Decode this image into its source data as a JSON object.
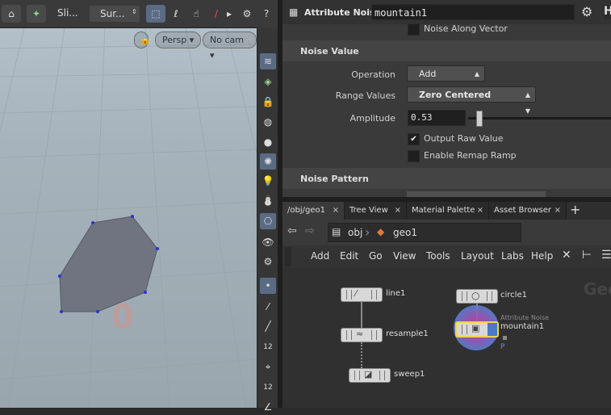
{
  "viewport": {
    "toolbar": {
      "select_label": "Sli...",
      "surface_label": "Sur..."
    },
    "camera_menu": "Persp",
    "cam_menu": "No cam",
    "overlay_digit": "0"
  },
  "shelf": {
    "icons": [
      "layers-icon",
      "visibility-icon",
      "lock-icon",
      "ghost-icon",
      "shading-icon",
      "light-icon",
      "light-bulb-icon",
      "render-icon",
      "camera-icon",
      "eye-icon",
      "settings-icon",
      "point-icon",
      "edge-icon",
      "face-icon",
      "number-icon",
      "brush-icon",
      "number2-icon",
      "angle-icon"
    ],
    "labels": {
      "number1": "12",
      "number2": "12"
    }
  },
  "params": {
    "node_type": "Attribute Noise",
    "node_name": "mountain1",
    "noise_along_vector": "Noise Along Vector",
    "sections": {
      "noise_value": "Noise Value",
      "noise_pattern": "Noise Pattern"
    },
    "operation_label": "Operation",
    "operation_value": "Add",
    "range_label": "Range Values",
    "range_value": "Zero Centered",
    "amplitude_label": "Amplitude",
    "amplitude_value": "0.53",
    "output_raw_label": "Output Raw Value",
    "enable_remap_label": "Enable Remap Ramp"
  },
  "network": {
    "tabs": [
      {
        "label": "/obj/geo1",
        "close": "×"
      },
      {
        "label": "Tree View",
        "close": "×"
      },
      {
        "label": "Material Palette",
        "close": "×"
      },
      {
        "label": "Asset Browser",
        "close": "×"
      }
    ],
    "add_tab": "+",
    "path": {
      "obj": "obj",
      "geo": "geo1"
    },
    "menu": [
      "Add",
      "Edit",
      "Go",
      "View",
      "Tools",
      "Layout",
      "Labs",
      "Help"
    ],
    "nodes": {
      "line": "line1",
      "resample": "resample1",
      "sweep": "sweep1",
      "circle": "circle1",
      "mountain_type": "Attribute Noise",
      "mountain": "mountain1",
      "mountain_flag": "P"
    },
    "watermark": "Geo"
  },
  "colors": {
    "accent": "#f3d24a",
    "select": "#5a6b84",
    "node_blue": "#4b79c8"
  }
}
